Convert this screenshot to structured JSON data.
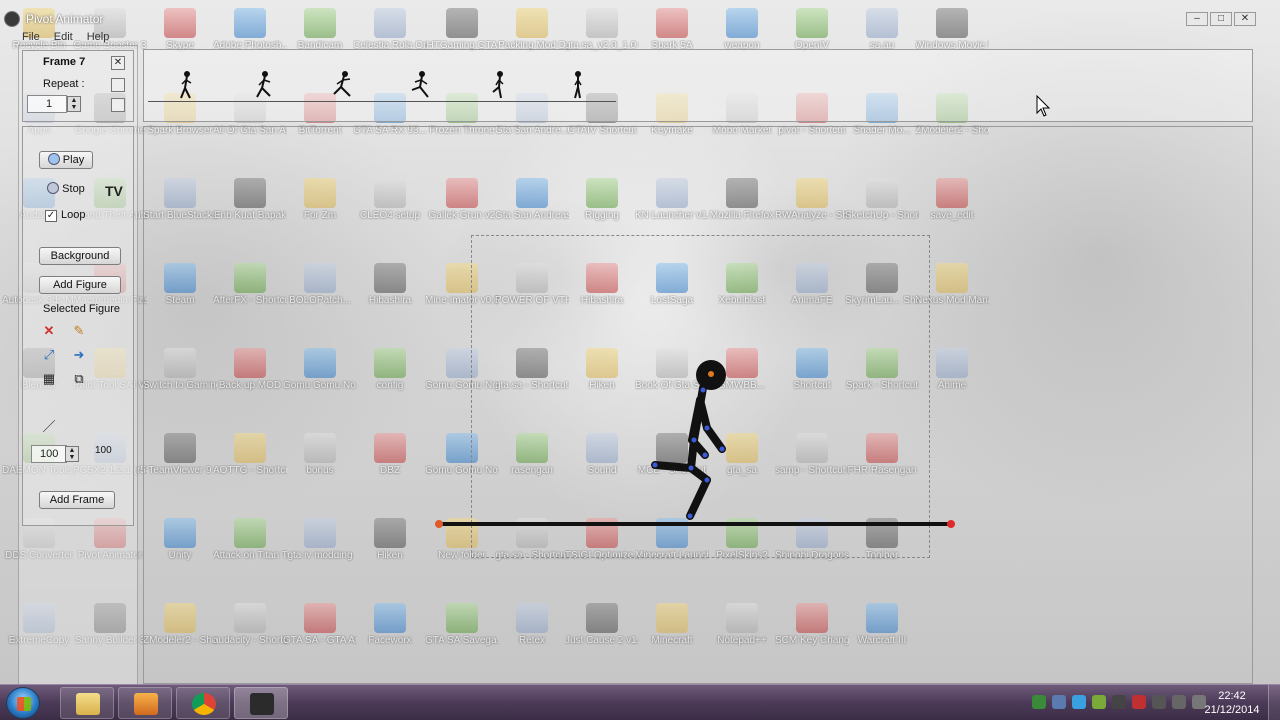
{
  "window": {
    "title": "Pivot Animator",
    "menu": [
      "File",
      "Edit",
      "Help"
    ],
    "controls": {
      "minimize": "–",
      "maximize": "□",
      "close": "✕"
    }
  },
  "frame_panel": {
    "frame_label": "Frame 7",
    "repeat_label": "Repeat :",
    "repeat_value": "1"
  },
  "controls_panel": {
    "play_label": "Play",
    "stop_label": "Stop",
    "loop_label": "Loop",
    "loop_checked": true,
    "background_label": "Background",
    "add_figure_label": "Add Figure",
    "selected_figure_label": "Selected Figure",
    "scale_value": "100",
    "scale_value_right": "100",
    "add_frame_label": "Add Frame"
  },
  "timeline": {
    "frames": 6
  },
  "taskbar": {
    "time": "22:42",
    "date": "21/12/2014",
    "apps": [
      "windows-explorer",
      "media-player",
      "chrome",
      "pivot-animator"
    ]
  },
  "desktop_icons": [
    "Recycle Bin",
    "Game Booster 3",
    "Skype",
    "Adobe Photosh...",
    "Bandicam",
    "Celestia Rola Online Alpha",
    "HTGaming GTA",
    "Packing Mod D",
    "gta sa_v2.0_1.0 os",
    "Spark 5A",
    "weapon",
    "OpenIV",
    "sa.au",
    "Windows Movie Mak...",
    "Apps",
    "Google Chrome",
    "Spark Browser",
    "All Of Gta San Andre...",
    "BitTorrent",
    "GTA SA RX 93...",
    "Frozen Throne",
    "Gta San Andre...",
    "GTAIV Shortcut",
    "Keymake",
    "Mobo Market",
    "pivot - Shortcut",
    "Shader Mo...",
    "ZModeler2 - Shortcut (2)",
    "Audacity",
    "Grand Theft Auto IV",
    "Start BlueStacks",
    "Enb Kuat Bapak",
    "For Zm",
    "CLEO4 setup",
    "Gallek Grun v2",
    "Gta San Andreas DBZ",
    "Rigging",
    "KN Launcher v1.401",
    "Mozilla Firefox",
    "RWAnalyze - Shortcut",
    "SketchUp - Shortcut",
    "save_edit",
    "Autodesk 3ds Max 2013...",
    "Macromedia Flash 8",
    "Steam",
    "AfterFX - Shortcut",
    "BOLOPatch...",
    "Hibashira",
    "Mine-imator v0.6a",
    "POWER OF VTHE TOMA...",
    "Hibashira",
    "LostSaga",
    "Xebulblast",
    "AnimaFE",
    "SkyrimLau... Shortcut",
    "Nexus Mod Manager",
    "Blender",
    "Paint Tool SAI Ver.1",
    "Switch to Gaming...",
    "Back up MOD",
    "Gomu Gomu No Rifle",
    "config",
    "Gomu Gomu No Bazooka",
    "gta sa - Shortcut (3)",
    "Hiken",
    "Book Of Gta San andreas",
    "SMWBB...",
    "Shortcut",
    "Spark - Shortcut",
    "Anime",
    "DAEMON Tools Lite",
    "PCSX2 1.2.1 (r5875)",
    "TeamViewer 9",
    "AOTTG - Shortcut",
    "bonus",
    "DBZ",
    "Gomu Gomu No Rifle",
    "rasengan",
    "Sound",
    "MCE - Shortcut",
    "gta_sa",
    "samp - Shortcut (2)",
    "FHR Rasengan",
    "DDS Converter",
    "Pivot Animator",
    "Unity",
    "Attack on Titan Tribu...",
    "gta iv modding",
    "Hiken",
    "New folder",
    "gta sa - Shortcut",
    "TSIGI Optimize...",
    "Minecraft Launch...",
    "PixelSkins2",
    "Shinobi Dragons Fl...",
    "Toolbar",
    "ExtremeCopy",
    "Sanny Builder 3",
    "ZModeler2 - Shortcut",
    "audacity - Shortcut",
    "GTA SA - GTA Ani...",
    "Faceworx",
    "GTA SA Savega...",
    "Retex",
    "Just Cause 2 v1.0.0.2 + 3...",
    "Minecraft",
    "Notepad++",
    "SCM Key Change...",
    "Warcraft III"
  ]
}
